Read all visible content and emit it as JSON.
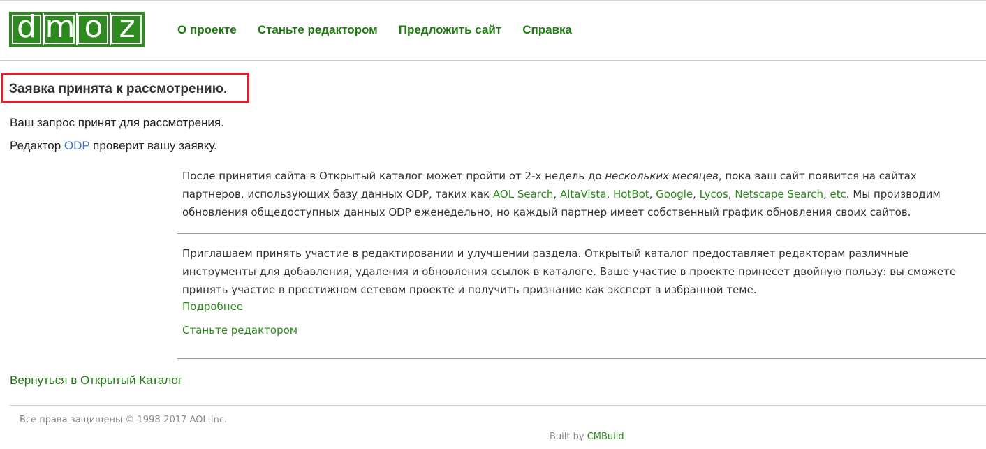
{
  "header": {
    "logo_letters": [
      "d",
      "m",
      "o",
      "z"
    ],
    "nav": [
      "О проекте",
      "Станьте редактором",
      "Предложить сайт",
      "Справка"
    ]
  },
  "main": {
    "title": "Заявка принята к рассмотрению.",
    "message_line1": "Ваш запрос принят для рассмотрения.",
    "message_line2_prefix": "Редактор ",
    "message_line2_odp": "ODP",
    "message_line2_suffix": " проверит вашу заявку.",
    "info1": {
      "part1": "После принятия сайта в Открытый каталог может пройти от 2-х недель до ",
      "emphasis": "нескольких месяцев",
      "part2": ", пока ваш сайт появится на сайтах партнеров, использующих базу данных ODP, таких как ",
      "partners": [
        "AOL Search",
        "AltaVista",
        "HotBot",
        "Google",
        "Lycos",
        "Netscape Search",
        "etc"
      ],
      "part3": ". Мы производим обновления общедоступных данных ODP еженедельно, но каждый партнер имеет собственный график обновления своих сайтов."
    },
    "info2": "Приглашаем принять участие в редактировании и улучшении раздела. Открытый каталог предоставляет редакторам различные инструменты для добавления, удаления и обновления ссылок в каталоге. Ваше участие в проекте принесет двойную пользу: вы сможете принять участие в престижном сетевом проекте и получить признание как эксперт в избранной теме.",
    "more_link": "Подробнее",
    "become_editor_link": "Станьте редактором",
    "back_link": "Вернуться в Открытый Каталог"
  },
  "footer": {
    "copyright": "Все права защищены © 1998-2017 AOL Inc.",
    "built_by_prefix": "Built by ",
    "built_by_link": "CMBuild"
  },
  "colors": {
    "brand_green": "#2d8a1f",
    "link_green": "#2a8a1a",
    "highlight_red": "#e0202e"
  }
}
